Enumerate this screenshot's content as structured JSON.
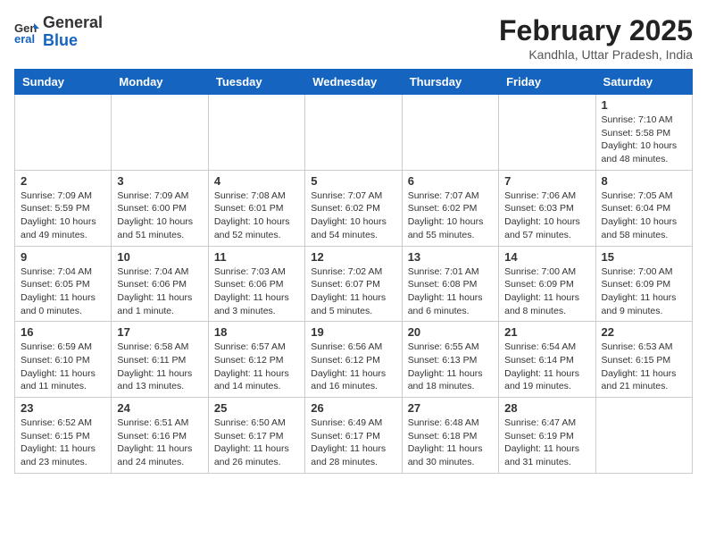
{
  "header": {
    "logo_general": "General",
    "logo_blue": "Blue",
    "month_title": "February 2025",
    "location": "Kandhla, Uttar Pradesh, India"
  },
  "weekdays": [
    "Sunday",
    "Monday",
    "Tuesday",
    "Wednesday",
    "Thursday",
    "Friday",
    "Saturday"
  ],
  "weeks": [
    [
      {
        "day": "",
        "info": ""
      },
      {
        "day": "",
        "info": ""
      },
      {
        "day": "",
        "info": ""
      },
      {
        "day": "",
        "info": ""
      },
      {
        "day": "",
        "info": ""
      },
      {
        "day": "",
        "info": ""
      },
      {
        "day": "1",
        "info": "Sunrise: 7:10 AM\nSunset: 5:58 PM\nDaylight: 10 hours\nand 48 minutes."
      }
    ],
    [
      {
        "day": "2",
        "info": "Sunrise: 7:09 AM\nSunset: 5:59 PM\nDaylight: 10 hours\nand 49 minutes."
      },
      {
        "day": "3",
        "info": "Sunrise: 7:09 AM\nSunset: 6:00 PM\nDaylight: 10 hours\nand 51 minutes."
      },
      {
        "day": "4",
        "info": "Sunrise: 7:08 AM\nSunset: 6:01 PM\nDaylight: 10 hours\nand 52 minutes."
      },
      {
        "day": "5",
        "info": "Sunrise: 7:07 AM\nSunset: 6:02 PM\nDaylight: 10 hours\nand 54 minutes."
      },
      {
        "day": "6",
        "info": "Sunrise: 7:07 AM\nSunset: 6:02 PM\nDaylight: 10 hours\nand 55 minutes."
      },
      {
        "day": "7",
        "info": "Sunrise: 7:06 AM\nSunset: 6:03 PM\nDaylight: 10 hours\nand 57 minutes."
      },
      {
        "day": "8",
        "info": "Sunrise: 7:05 AM\nSunset: 6:04 PM\nDaylight: 10 hours\nand 58 minutes."
      }
    ],
    [
      {
        "day": "9",
        "info": "Sunrise: 7:04 AM\nSunset: 6:05 PM\nDaylight: 11 hours\nand 0 minutes."
      },
      {
        "day": "10",
        "info": "Sunrise: 7:04 AM\nSunset: 6:06 PM\nDaylight: 11 hours\nand 1 minute."
      },
      {
        "day": "11",
        "info": "Sunrise: 7:03 AM\nSunset: 6:06 PM\nDaylight: 11 hours\nand 3 minutes."
      },
      {
        "day": "12",
        "info": "Sunrise: 7:02 AM\nSunset: 6:07 PM\nDaylight: 11 hours\nand 5 minutes."
      },
      {
        "day": "13",
        "info": "Sunrise: 7:01 AM\nSunset: 6:08 PM\nDaylight: 11 hours\nand 6 minutes."
      },
      {
        "day": "14",
        "info": "Sunrise: 7:00 AM\nSunset: 6:09 PM\nDaylight: 11 hours\nand 8 minutes."
      },
      {
        "day": "15",
        "info": "Sunrise: 7:00 AM\nSunset: 6:09 PM\nDaylight: 11 hours\nand 9 minutes."
      }
    ],
    [
      {
        "day": "16",
        "info": "Sunrise: 6:59 AM\nSunset: 6:10 PM\nDaylight: 11 hours\nand 11 minutes."
      },
      {
        "day": "17",
        "info": "Sunrise: 6:58 AM\nSunset: 6:11 PM\nDaylight: 11 hours\nand 13 minutes."
      },
      {
        "day": "18",
        "info": "Sunrise: 6:57 AM\nSunset: 6:12 PM\nDaylight: 11 hours\nand 14 minutes."
      },
      {
        "day": "19",
        "info": "Sunrise: 6:56 AM\nSunset: 6:12 PM\nDaylight: 11 hours\nand 16 minutes."
      },
      {
        "day": "20",
        "info": "Sunrise: 6:55 AM\nSunset: 6:13 PM\nDaylight: 11 hours\nand 18 minutes."
      },
      {
        "day": "21",
        "info": "Sunrise: 6:54 AM\nSunset: 6:14 PM\nDaylight: 11 hours\nand 19 minutes."
      },
      {
        "day": "22",
        "info": "Sunrise: 6:53 AM\nSunset: 6:15 PM\nDaylight: 11 hours\nand 21 minutes."
      }
    ],
    [
      {
        "day": "23",
        "info": "Sunrise: 6:52 AM\nSunset: 6:15 PM\nDaylight: 11 hours\nand 23 minutes."
      },
      {
        "day": "24",
        "info": "Sunrise: 6:51 AM\nSunset: 6:16 PM\nDaylight: 11 hours\nand 24 minutes."
      },
      {
        "day": "25",
        "info": "Sunrise: 6:50 AM\nSunset: 6:17 PM\nDaylight: 11 hours\nand 26 minutes."
      },
      {
        "day": "26",
        "info": "Sunrise: 6:49 AM\nSunset: 6:17 PM\nDaylight: 11 hours\nand 28 minutes."
      },
      {
        "day": "27",
        "info": "Sunrise: 6:48 AM\nSunset: 6:18 PM\nDaylight: 11 hours\nand 30 minutes."
      },
      {
        "day": "28",
        "info": "Sunrise: 6:47 AM\nSunset: 6:19 PM\nDaylight: 11 hours\nand 31 minutes."
      },
      {
        "day": "",
        "info": ""
      }
    ]
  ]
}
